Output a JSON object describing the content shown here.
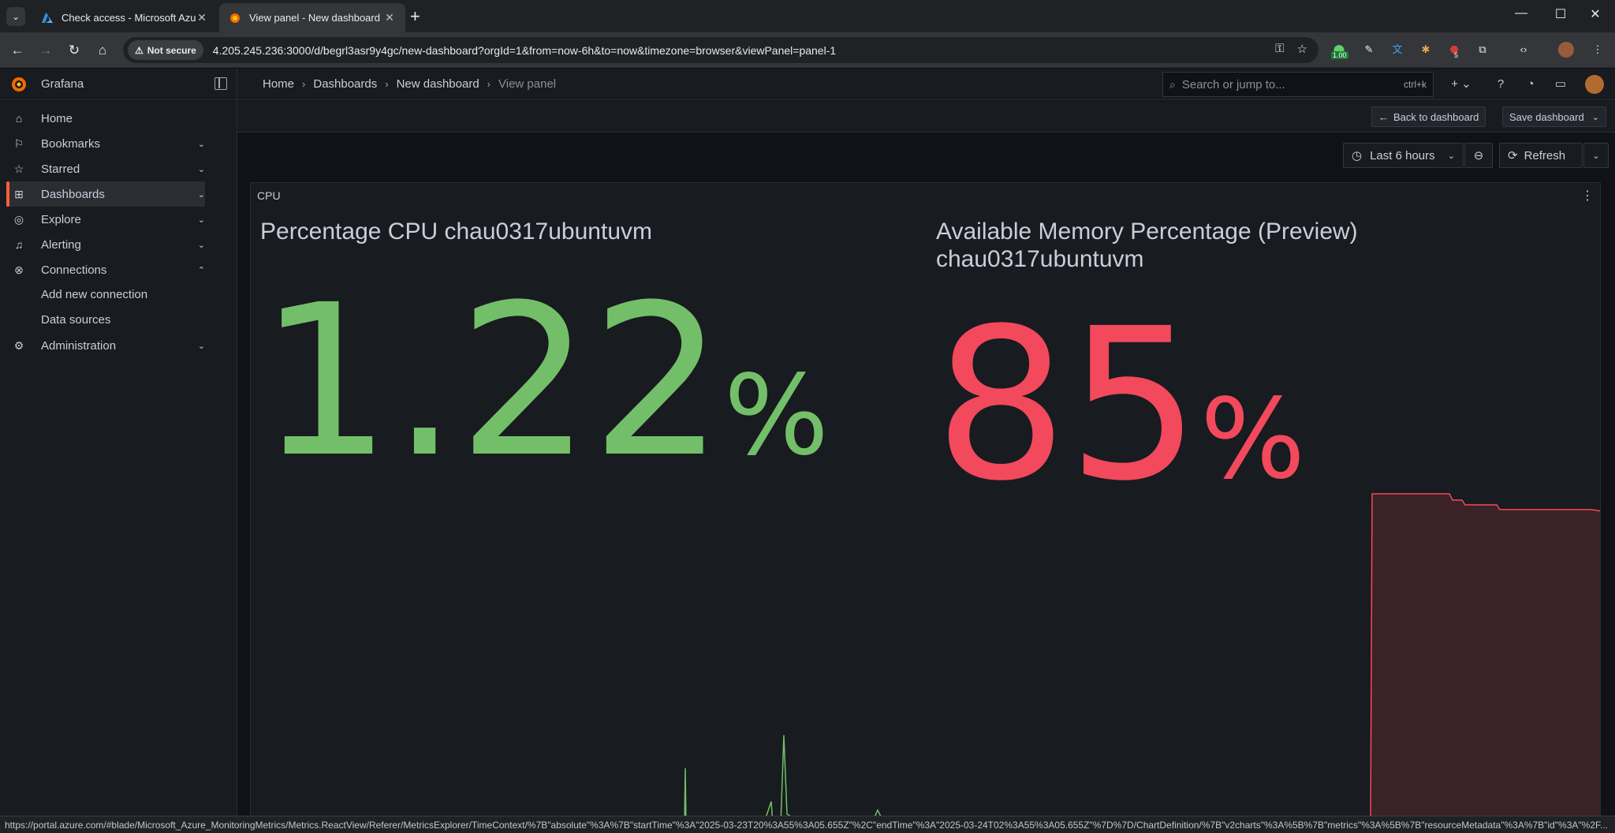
{
  "browser": {
    "tabs": [
      {
        "title": "Check access - Microsoft Azure",
        "active": false
      },
      {
        "title": "View panel - New dashboard - …",
        "active": true
      }
    ],
    "security_label": "Not secure",
    "url": "4.205.245.236:3000/d/begrl3asr9y4gc/new-dashboard?orgId=1&from=now-6h&to=now&timezone=browser&viewPanel=panel-1",
    "extension_badge": "1.00",
    "extension_badge2": "5",
    "status_url": "https://portal.azure.com/#blade/Microsoft_Azure_MonitoringMetrics/Metrics.ReactView/Referer/MetricsExplorer/TimeContext/%7B\"absolute\"%3A%7B\"startTime\"%3A\"2025-03-23T20%3A55%3A05.655Z\"%2C\"endTime\"%3A\"2025-03-24T02%3A55%3A05.655Z\"%7D%7D/ChartDefinition/%7B\"v2charts\"%3A%5B%7B\"metrics\"%3A%5B%7B\"resourceMetadata\"%3A%7B\"id\"%3A\"%2F..."
  },
  "grafana": {
    "brand": "Grafana",
    "breadcrumb": [
      "Home",
      "Dashboards",
      "New dashboard",
      "View panel"
    ],
    "search": {
      "placeholder": "Search or jump to...",
      "shortcut": "ctrl+k"
    },
    "nav": [
      {
        "label": "Home",
        "icon": "home-icon",
        "expandable": false
      },
      {
        "label": "Bookmarks",
        "icon": "bookmark-icon",
        "expandable": true
      },
      {
        "label": "Starred",
        "icon": "star-icon",
        "expandable": true
      },
      {
        "label": "Dashboards",
        "icon": "apps-icon",
        "expandable": true,
        "active": true
      },
      {
        "label": "Explore",
        "icon": "compass-icon",
        "expandable": true
      },
      {
        "label": "Alerting",
        "icon": "bell-icon",
        "expandable": true
      },
      {
        "label": "Connections",
        "icon": "connections-icon",
        "expandable": true,
        "expanded": true
      },
      {
        "label": "Administration",
        "icon": "cog-icon",
        "expandable": true
      }
    ],
    "connections_sub": [
      "Add new connection",
      "Data sources"
    ],
    "actions": {
      "back": "Back to dashboard",
      "save": "Save dashboard"
    },
    "time_picker": "Last 6 hours",
    "refresh": "Refresh",
    "panel": {
      "title": "CPU",
      "stats": [
        {
          "title": "Percentage CPU chau0317ubuntuvm",
          "value": "1.22",
          "unit": "%",
          "color": "#73bf69"
        },
        {
          "title": "Available Memory Percentage (Preview) chau0317ubuntuvm",
          "value": "85",
          "unit": "%",
          "color": "#f2495c"
        }
      ]
    }
  }
}
